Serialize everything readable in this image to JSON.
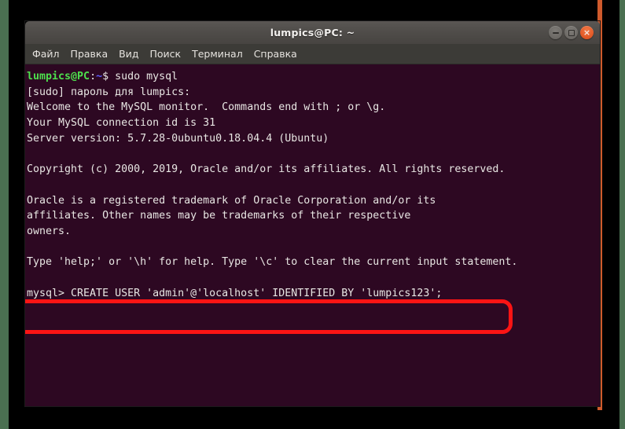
{
  "window": {
    "title": "lumpics@PC: ~",
    "controls": [
      {
        "name": "minimize",
        "glyph": ""
      },
      {
        "name": "maximize",
        "glyph": ""
      },
      {
        "name": "close",
        "glyph": "×"
      }
    ],
    "colors": {
      "titlebar": "#504d4a",
      "menubar": "#3c3b37",
      "terminal_bg": "#2d0822",
      "prompt_green": "#4de04d",
      "prompt_blue": "#5c5cff",
      "close_button": "#e35b28",
      "annotation_red": "#fb1414",
      "desktop_green": "#4a7051",
      "desktop_orange": "#cf5a2c"
    }
  },
  "menu": {
    "items": [
      {
        "label": "Файл"
      },
      {
        "label": "Правка"
      },
      {
        "label": "Вид"
      },
      {
        "label": "Поиск"
      },
      {
        "label": "Терминал"
      },
      {
        "label": "Справка"
      }
    ]
  },
  "terminal": {
    "prompt": {
      "user_host": "lumpics@PC",
      "colon": ":",
      "path": "~",
      "sigil": "$"
    },
    "lines": [
      {
        "type": "prompt",
        "command": "sudo mysql"
      },
      {
        "type": "text",
        "text": "[sudo] пароль для lumpics:"
      },
      {
        "type": "text",
        "text": "Welcome to the MySQL monitor.  Commands end with ; or \\g."
      },
      {
        "type": "text",
        "text": "Your MySQL connection id is 31"
      },
      {
        "type": "text",
        "text": "Server version: 5.7.28-0ubuntu0.18.04.4 (Ubuntu)"
      },
      {
        "type": "text",
        "text": ""
      },
      {
        "type": "text",
        "text": "Copyright (c) 2000, 2019, Oracle and/or its affiliates. All rights reserved."
      },
      {
        "type": "text",
        "text": ""
      },
      {
        "type": "text",
        "text": "Oracle is a registered trademark of Oracle Corporation and/or its"
      },
      {
        "type": "text",
        "text": "affiliates. Other names may be trademarks of their respective"
      },
      {
        "type": "text",
        "text": "owners."
      },
      {
        "type": "text",
        "text": ""
      },
      {
        "type": "text",
        "text": "Type 'help;' or '\\h' for help. Type '\\c' to clear the current input statement."
      },
      {
        "type": "text",
        "text": ""
      },
      {
        "type": "text",
        "text": "mysql> CREATE USER 'admin'@'localhost' IDENTIFIED BY 'lumpics123';"
      }
    ],
    "highlighted_command": "mysql> CREATE USER 'admin'@'localhost' IDENTIFIED BY 'lumpics123';"
  }
}
